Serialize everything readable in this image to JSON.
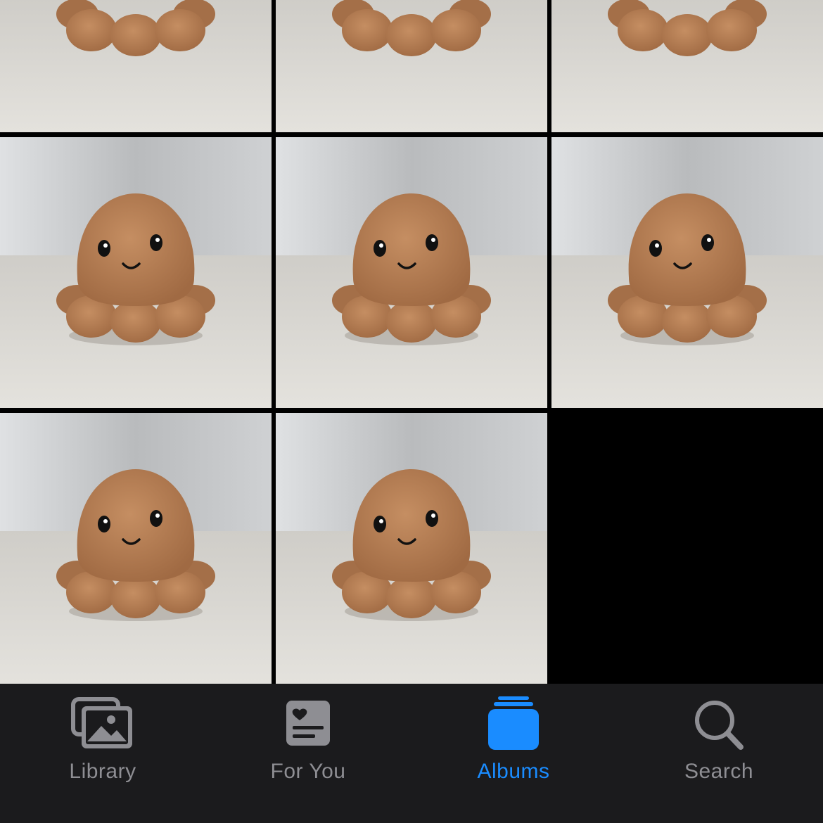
{
  "photo_grid": {
    "photos": [
      {
        "alt": "octopus-plush-photo"
      },
      {
        "alt": "octopus-plush-photo"
      },
      {
        "alt": "octopus-plush-photo"
      },
      {
        "alt": "octopus-plush-photo"
      },
      {
        "alt": "octopus-plush-photo"
      },
      {
        "alt": "octopus-plush-photo"
      },
      {
        "alt": "octopus-plush-photo"
      },
      {
        "alt": "octopus-plush-photo"
      }
    ]
  },
  "tab_bar": {
    "active_color": "#1a8cff",
    "inactive_color": "#8e8e93",
    "tabs": [
      {
        "label": "Library",
        "icon": "photo-library-icon",
        "active": false
      },
      {
        "label": "For You",
        "icon": "for-you-icon",
        "active": false
      },
      {
        "label": "Albums",
        "icon": "albums-icon",
        "active": true
      },
      {
        "label": "Search",
        "icon": "search-icon",
        "active": false
      }
    ]
  }
}
